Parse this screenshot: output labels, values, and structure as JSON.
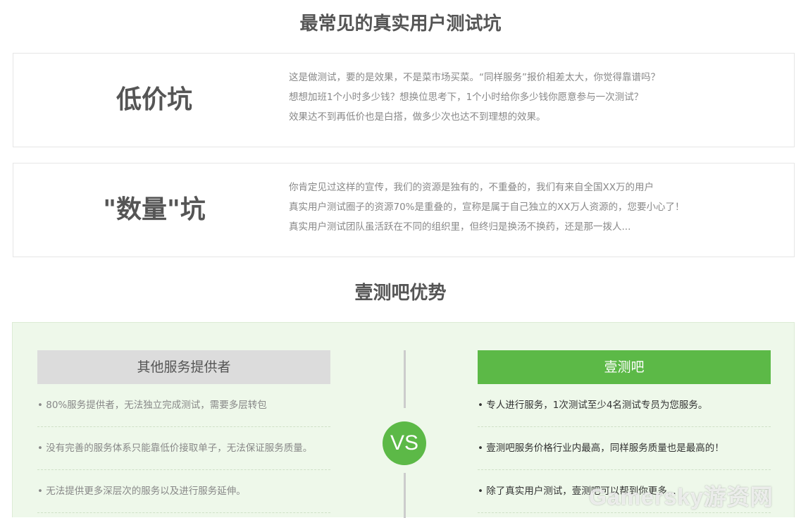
{
  "sections": {
    "pits_title": "最常见的真实用户测试坑",
    "advantage_title": "壹测吧优势"
  },
  "pits": [
    {
      "name": "低价坑",
      "lines": [
        "这是做测试，要的是效果，不是菜市场买菜。“同样服务”报价相差太大，你觉得靠谱吗？",
        "想想加班1个小时多少钱？想换位思考下，1个小时给你多少钱你愿意参与一次测试？",
        "效果达不到再低价也是白搭，做多少次也达不到理想的效果。"
      ]
    },
    {
      "name": "\"数量\"坑",
      "lines": [
        "你肯定见过这样的宣传，我们的资源是独有的，不重叠的，我们有来自全国XX万的用户",
        "真实用户测试圈子的资源70%是重叠的，宣称是属于自己独立的XX万人资源的，您要小心了！",
        "真实用户测试团队虽活跃在不同的组织里，但终归是换汤不换药，还是那一拨人..."
      ]
    }
  ],
  "comparison": {
    "left": {
      "title": "其他服务提供者",
      "items": [
        "• 80%服务提供者，无法独立完成测试，需要多层转包",
        "• 没有完善的服务体系只能靠低价接取单子，无法保证服务质量。",
        "• 无法提供更多深层次的服务以及进行服务延伸。"
      ]
    },
    "vs": "VS",
    "right": {
      "title": "壹测吧",
      "items": [
        "• 专人进行服务，1次测试至少4名测试专员为您服务。",
        "• 壹测吧服务价格行业内最高，同样服务质量也是最高的！",
        "• 除了真实用户测试，壹测吧可以帮到你更多..."
      ]
    }
  },
  "watermark": "Gamersky游资网",
  "colors": {
    "accent_green": "#5cb947",
    "panel_bg": "#eef8ea",
    "title_text": "#555555"
  }
}
